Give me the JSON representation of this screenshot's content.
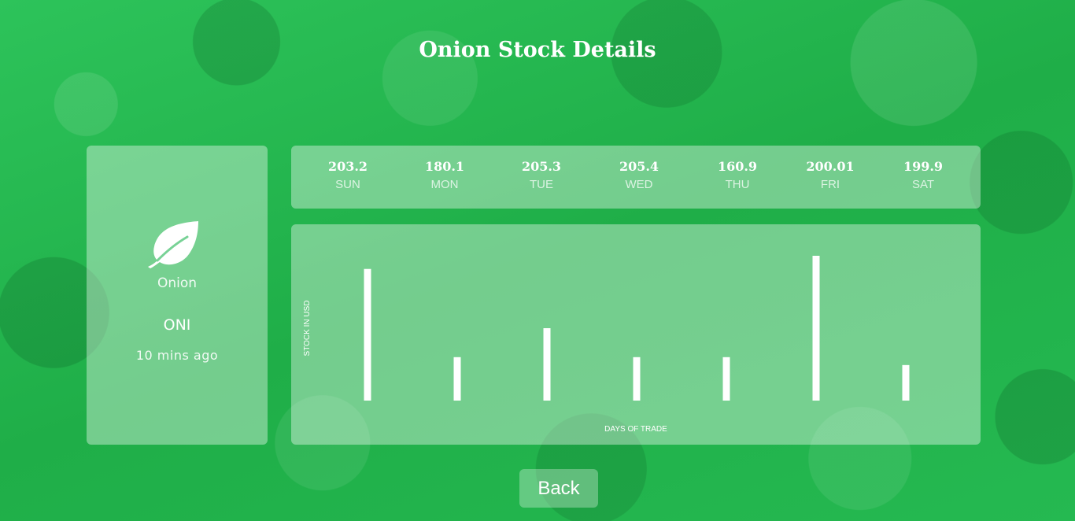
{
  "page": {
    "title": "Onion Stock Details",
    "background_color": "#22b14c"
  },
  "commodity": {
    "icon": "leaf-icon",
    "name": "Onion",
    "ticker": "ONI",
    "updated": "10 mins ago"
  },
  "days": [
    {
      "value": "203.2",
      "label": "SUN"
    },
    {
      "value": "180.1",
      "label": "MON"
    },
    {
      "value": "205.3",
      "label": "TUE"
    },
    {
      "value": "205.4",
      "label": "WED"
    },
    {
      "value": "160.9",
      "label": "THU"
    },
    {
      "value": "200.01",
      "label": "FRI"
    },
    {
      "value": "199.9",
      "label": "SAT"
    }
  ],
  "chart_data": {
    "type": "bar",
    "categories": [
      "SUN",
      "MON",
      "TUE",
      "WED",
      "THU",
      "FRI",
      "SAT"
    ],
    "values": [
      100,
      33,
      55,
      33,
      33,
      110,
      27
    ],
    "ylim": [
      0,
      110
    ],
    "xlabel": "DAYS OF TRADE",
    "ylabel": "STOCK IN USD",
    "bar_color": "#ffffff",
    "grid": false
  },
  "actions": {
    "back_label": "Back"
  }
}
